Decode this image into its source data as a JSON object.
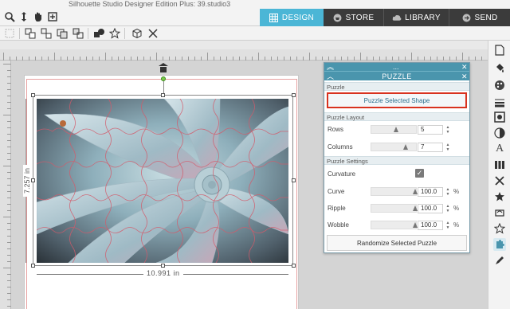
{
  "app": {
    "title": "Silhouette Studio Designer Edition Plus: 39.studio3"
  },
  "quick_access": [
    {
      "icon": "zoom-select-icon"
    },
    {
      "icon": "move-icon"
    },
    {
      "icon": "pan-hand-icon"
    },
    {
      "icon": "fit-to-page-icon"
    }
  ],
  "tabs": [
    {
      "label": "DESIGN",
      "icon": "grid-icon",
      "active": true
    },
    {
      "label": "STORE",
      "icon": "store-icon",
      "active": false
    },
    {
      "label": "LIBRARY",
      "icon": "cloud-icon",
      "active": false
    },
    {
      "label": "SEND",
      "icon": "send-icon",
      "active": false
    }
  ],
  "tools": [
    {
      "icon": "group-icon"
    },
    {
      "icon": "ungroup-icon"
    },
    {
      "icon": "make-compound-icon"
    },
    {
      "icon": "release-compound-icon"
    },
    {
      "icon": "shapes-icon"
    },
    {
      "icon": "star-icon"
    },
    {
      "icon": "3d-box-icon"
    },
    {
      "icon": "close-icon"
    }
  ],
  "canvas": {
    "width_label": "10.991 in",
    "height_label": "7.257 in"
  },
  "panel": {
    "title": "PUZZLE",
    "header_icon": "...",
    "sections": {
      "puzzle": "Puzzle",
      "layout": "Puzzle Layout",
      "settings": "Puzzle Settings"
    },
    "puzzle_button": "Puzzle Selected Shape",
    "rows_label": "Rows",
    "rows_value": "5",
    "rows_fraction": 0.55,
    "columns_label": "Columns",
    "columns_value": "7",
    "columns_fraction": 0.8,
    "curvature_label": "Curvature",
    "curvature_checked": true,
    "curve_label": "Curve",
    "curve_value": "100.0",
    "ripple_label": "Ripple",
    "ripple_value": "100.0",
    "wobble_label": "Wobble",
    "wobble_value": "100.0",
    "unit": "%",
    "randomize_button": "Randomize Selected Puzzle"
  },
  "right_rail": [
    {
      "icon": "page-setup-icon"
    },
    {
      "icon": "fill-icon"
    },
    {
      "icon": "color-palette-icon"
    },
    {
      "icon": "line-style-icon"
    },
    {
      "icon": "image-effects-icon"
    },
    {
      "icon": "contrast-icon"
    },
    {
      "icon": "text-icon"
    },
    {
      "icon": "replicate-icon"
    },
    {
      "icon": "cut-settings-icon"
    },
    {
      "icon": "star-shape-icon"
    },
    {
      "icon": "rhinestone-icon"
    },
    {
      "icon": "layers-icon"
    },
    {
      "icon": "puzzle-icon"
    },
    {
      "icon": "sketch-icon"
    }
  ]
}
